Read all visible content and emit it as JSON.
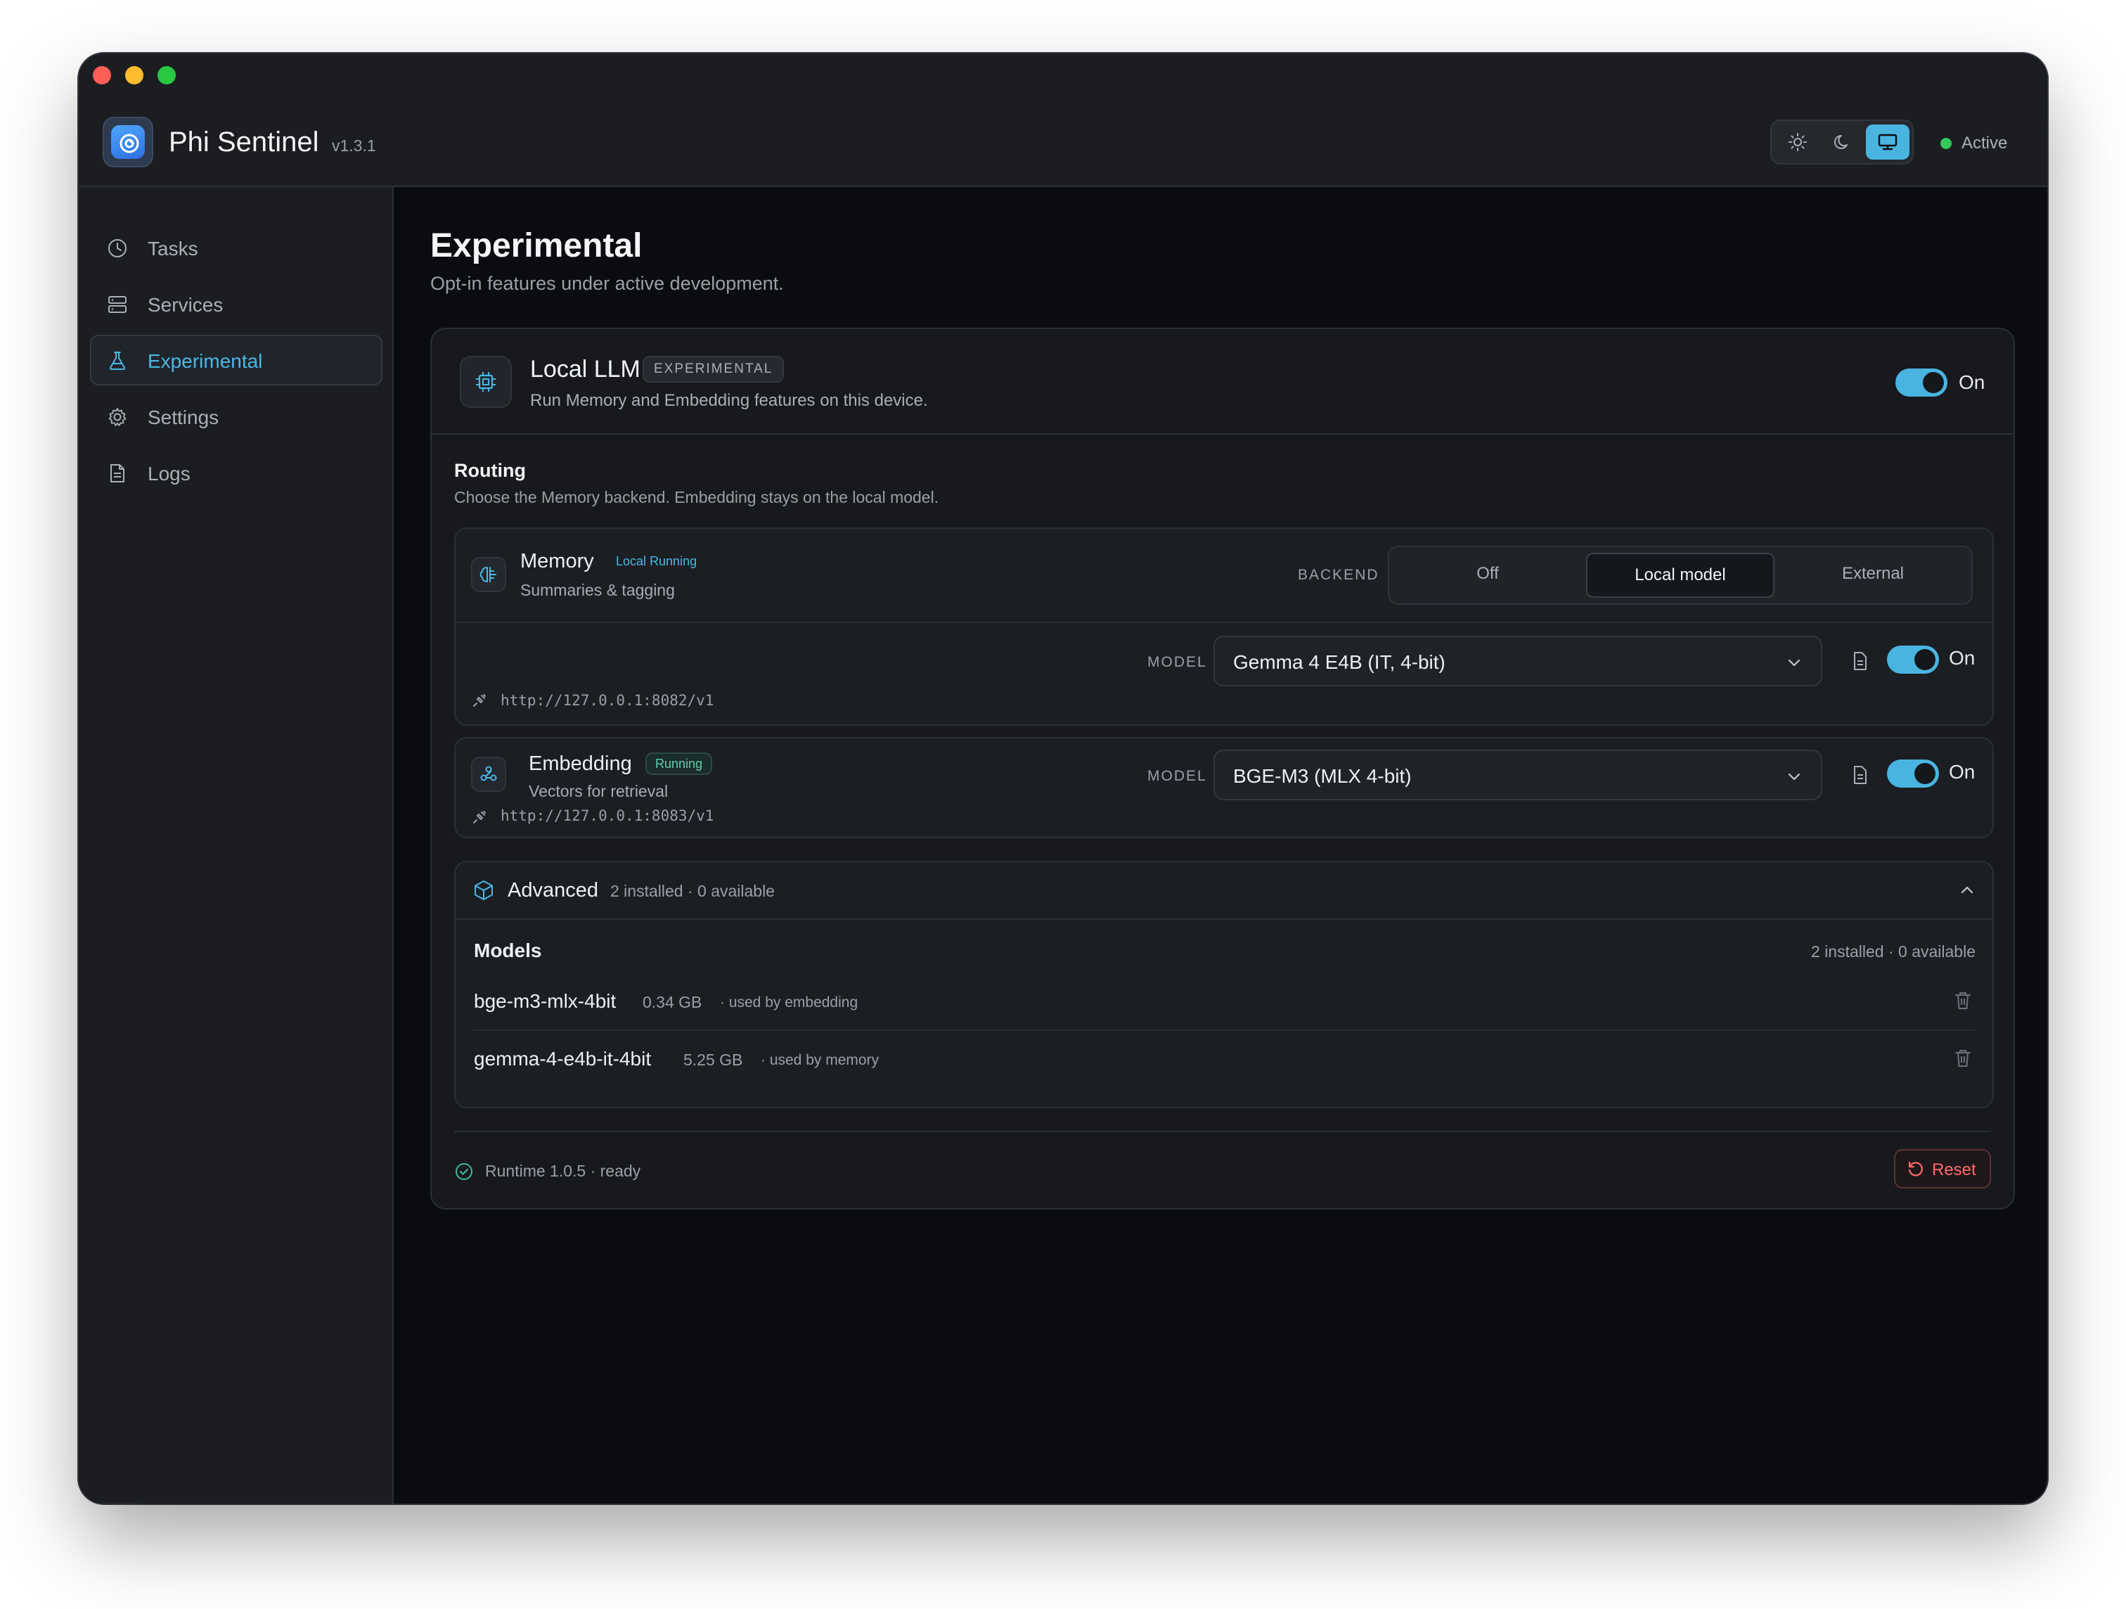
{
  "app": {
    "name": "Phi Sentinel",
    "version": "v1.3.1",
    "status": "Active",
    "accent_color": "#4ab4e1",
    "status_color": "#34c759",
    "theme_options": [
      "light",
      "dark",
      "system"
    ],
    "theme_selected": "system"
  },
  "sidebar": {
    "items": [
      {
        "label": "Tasks",
        "icon": "clock-icon"
      },
      {
        "label": "Services",
        "icon": "server-icon"
      },
      {
        "label": "Experimental",
        "icon": "flask-icon",
        "active": true
      },
      {
        "label": "Settings",
        "icon": "gear-icon"
      },
      {
        "label": "Logs",
        "icon": "file-icon"
      }
    ]
  },
  "page": {
    "title": "Experimental",
    "subtitle": "Opt-in features under active development."
  },
  "local_llm": {
    "title": "Local LLM",
    "badge": "EXPERIMENTAL",
    "description": "Run Memory and Embedding features on this device.",
    "toggle_label": "On",
    "enabled": true,
    "routing": {
      "title": "Routing",
      "description": "Choose the Memory backend. Embedding stays on the local model."
    },
    "memory": {
      "title": "Memory",
      "badge": "Local Running",
      "subtitle": "Summaries & tagging",
      "backend_label": "BACKEND",
      "backend_options": [
        "Off",
        "Local model",
        "External"
      ],
      "backend_selected": "Local model",
      "model_label": "MODEL",
      "model_value": "Gemma 4 E4B (IT, 4-bit)",
      "toggle_label": "On",
      "enabled": true,
      "url": "http://127.0.0.1:8082/v1"
    },
    "embedding": {
      "title": "Embedding",
      "badge": "Running",
      "subtitle": "Vectors for retrieval",
      "model_label": "MODEL",
      "model_value": "BGE-M3 (MLX 4-bit)",
      "toggle_label": "On",
      "enabled": true,
      "url": "http://127.0.0.1:8083/v1"
    },
    "advanced": {
      "title": "Advanced",
      "meta": "2 installed · 0 available",
      "models_title": "Models",
      "models_meta": "2 installed · 0 available",
      "models": [
        {
          "name": "bge-m3-mlx-4bit",
          "size": "0.34 GB",
          "used_by": "· used by embedding"
        },
        {
          "name": "gemma-4-e4b-it-4bit",
          "size": "5.25 GB",
          "used_by": "· used by memory"
        }
      ]
    },
    "footer": {
      "runtime": "Runtime 1.0.5 · ready",
      "reset_label": "Reset"
    }
  }
}
